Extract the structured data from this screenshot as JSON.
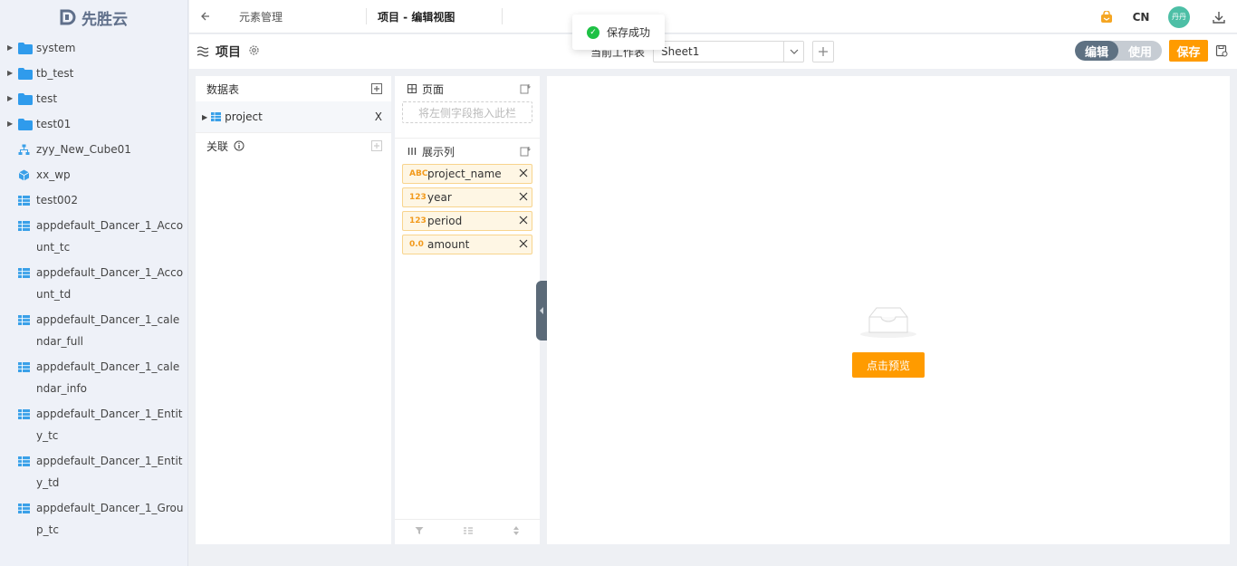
{
  "logo": {
    "text": "先胜云"
  },
  "sidebar": {
    "items": [
      {
        "label": "system",
        "icon": "folder-icon",
        "expandable": true
      },
      {
        "label": "tb_test",
        "icon": "folder-icon",
        "expandable": true
      },
      {
        "label": "test",
        "icon": "folder-icon",
        "expandable": true
      },
      {
        "label": "test01",
        "icon": "folder-icon",
        "expandable": true
      },
      {
        "label": "zyy_New_Cube01",
        "icon": "cube-model-icon",
        "expandable": false
      },
      {
        "label": "xx_wp",
        "icon": "box-icon",
        "expandable": false
      },
      {
        "label": "test002",
        "icon": "table-icon",
        "expandable": false
      },
      {
        "label": "appdefault_Dancer_1_Account_tc",
        "icon": "table-icon",
        "expandable": false
      },
      {
        "label": "appdefault_Dancer_1_Account_td",
        "icon": "table-icon",
        "expandable": false
      },
      {
        "label": "appdefault_Dancer_1_calendar_full",
        "icon": "table-icon",
        "expandable": false
      },
      {
        "label": "appdefault_Dancer_1_calendar_info",
        "icon": "table-icon",
        "expandable": false
      },
      {
        "label": "appdefault_Dancer_1_Entity_tc",
        "icon": "table-icon",
        "expandable": false
      },
      {
        "label": "appdefault_Dancer_1_Entity_td",
        "icon": "table-icon",
        "expandable": false
      },
      {
        "label": "appdefault_Dancer_1_Group_tc",
        "icon": "table-icon",
        "expandable": false
      }
    ]
  },
  "topbar": {
    "breadcrumb": "元素管理",
    "title": "项目 - 编辑视图",
    "lang": "CN",
    "avatar": "丹丹"
  },
  "toast": {
    "text": "保存成功"
  },
  "subbar": {
    "title": "项目",
    "sheet_label": "当前工作表",
    "sheet_value": "Sheet1",
    "mode_edit": "编辑",
    "mode_use": "使用",
    "save": "保存"
  },
  "panel_tables": {
    "header": "数据表",
    "tables": [
      {
        "name": "project",
        "remove": "X"
      }
    ],
    "relation_header": "关联"
  },
  "panel_fields": {
    "page_header": "页面",
    "drop_placeholder": "将左侧字段拖入此栏",
    "columns_header": "展示列",
    "fields": [
      {
        "type": "ABC",
        "name": "project_name"
      },
      {
        "type": "123",
        "name": "year"
      },
      {
        "type": "123",
        "name": "period"
      },
      {
        "type": "0.0",
        "name": "amount"
      }
    ]
  },
  "preview": {
    "button": "点击预览"
  },
  "colors": {
    "accent": "#ff9b00",
    "folder": "#2f9bec",
    "toggle_on": "#5e7182",
    "success": "#1ec145"
  }
}
